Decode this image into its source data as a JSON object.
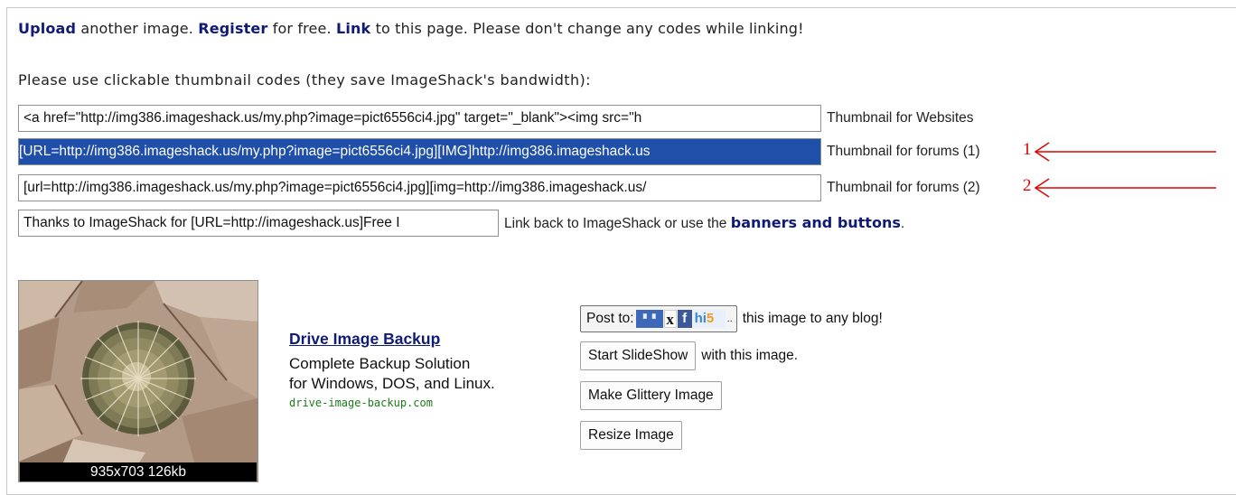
{
  "top_links": {
    "upload": "Upload",
    "upload_rest": " another image. ",
    "register": "Register",
    "register_rest": " for free. ",
    "link": "Link",
    "link_rest": " to this page. Please don't change any codes while linking!"
  },
  "note": "Please use clickable thumbnail codes (they save ImageShack's bandwidth):",
  "code_rows": [
    {
      "value": "<a href=\"http://img386.imageshack.us/my.php?image=pict6556ci4.jpg\" target=\"_blank\"><img src=\"h",
      "label": "Thumbnail for Websites"
    },
    {
      "value": "[URL=http://img386.imageshack.us/my.php?image=pict6556ci4.jpg][IMG]http://img386.imageshack.us",
      "label": "Thumbnail for forums (1)",
      "marker": "1"
    },
    {
      "value": "[url=http://img386.imageshack.us/my.php?image=pict6556ci4.jpg][img=http://img386.imageshack.us/",
      "label": "Thumbnail for forums (2)",
      "marker": "2"
    },
    {
      "value": "Thanks to ImageShack for [URL=http://imageshack.us]Free I",
      "label": "Link back to ImageShack or use the ",
      "link": "banners and buttons",
      "suffix": "."
    }
  ],
  "thumbnail": {
    "caption": "935x703 126kb"
  },
  "ad": {
    "title": "Drive Image Backup",
    "line1": "Complete Backup Solution",
    "line2": "for Windows, DOS, and Linux.",
    "url": "drive-image-backup.com"
  },
  "actions": {
    "post_label": "Post to:",
    "post_logo_more": "..",
    "post_text": "this image to any blog!",
    "slideshow_label": "Start SlideShow",
    "slideshow_text": "with this image.",
    "glitter_label": "Make Glittery Image",
    "resize_label": "Resize Image"
  },
  "colors": {
    "link": "#101a77",
    "annotation": "#e00000",
    "selection": "#1f4fa8",
    "ad_url": "#1a7b1a"
  }
}
